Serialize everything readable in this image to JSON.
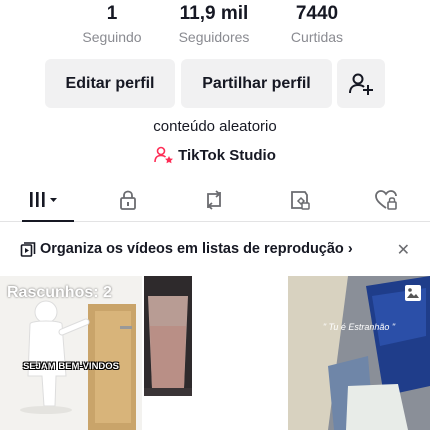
{
  "stats": [
    {
      "value": "1",
      "label": "Seguindo"
    },
    {
      "value": "11,9 mil",
      "label": "Seguidores"
    },
    {
      "value": "7440",
      "label": "Curtidas"
    }
  ],
  "buttons": {
    "edit": "Editar perfil",
    "share": "Partilhar perfil"
  },
  "bio": "conteúdo aleatorio",
  "studio": "TikTok Studio",
  "tabs": [
    "videos-grid",
    "private",
    "reposts",
    "saved",
    "liked"
  ],
  "playlist_banner": "Organiza os vídeos em listas de reprodução",
  "grid": {
    "drafts_label": "Rascunhos: 2",
    "welcome_caption": "SEJAM BEM-VINDOS",
    "estranhao_caption": "\" Tu é Estranhão \""
  },
  "colors": {
    "text": "#161823",
    "muted": "#8a8b91",
    "button_bg": "#f1f1f2",
    "accent": "#fe2c55"
  }
}
